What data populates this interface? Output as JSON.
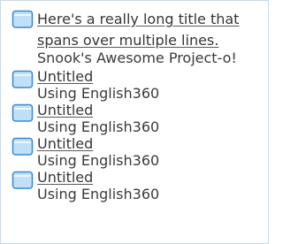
{
  "documents": [
    {
      "title": "Here's a really long title that spans over multiple lines.",
      "project": "Snook's Awesome Project-o!",
      "icon": "document-icon"
    },
    {
      "title": "Untitled",
      "project": "Using English360",
      "icon": "document-icon"
    },
    {
      "title": "Untitled",
      "project": "Using English360",
      "icon": "document-icon"
    },
    {
      "title": "Untitled",
      "project": "Using English360",
      "icon": "document-icon"
    },
    {
      "title": "Untitled",
      "project": "Using English360",
      "icon": "document-icon"
    }
  ],
  "colors": {
    "border": "#c9d9ea",
    "icon_fill": "#bfe0f7",
    "icon_stroke": "#3f87c8",
    "text": "#363636"
  }
}
